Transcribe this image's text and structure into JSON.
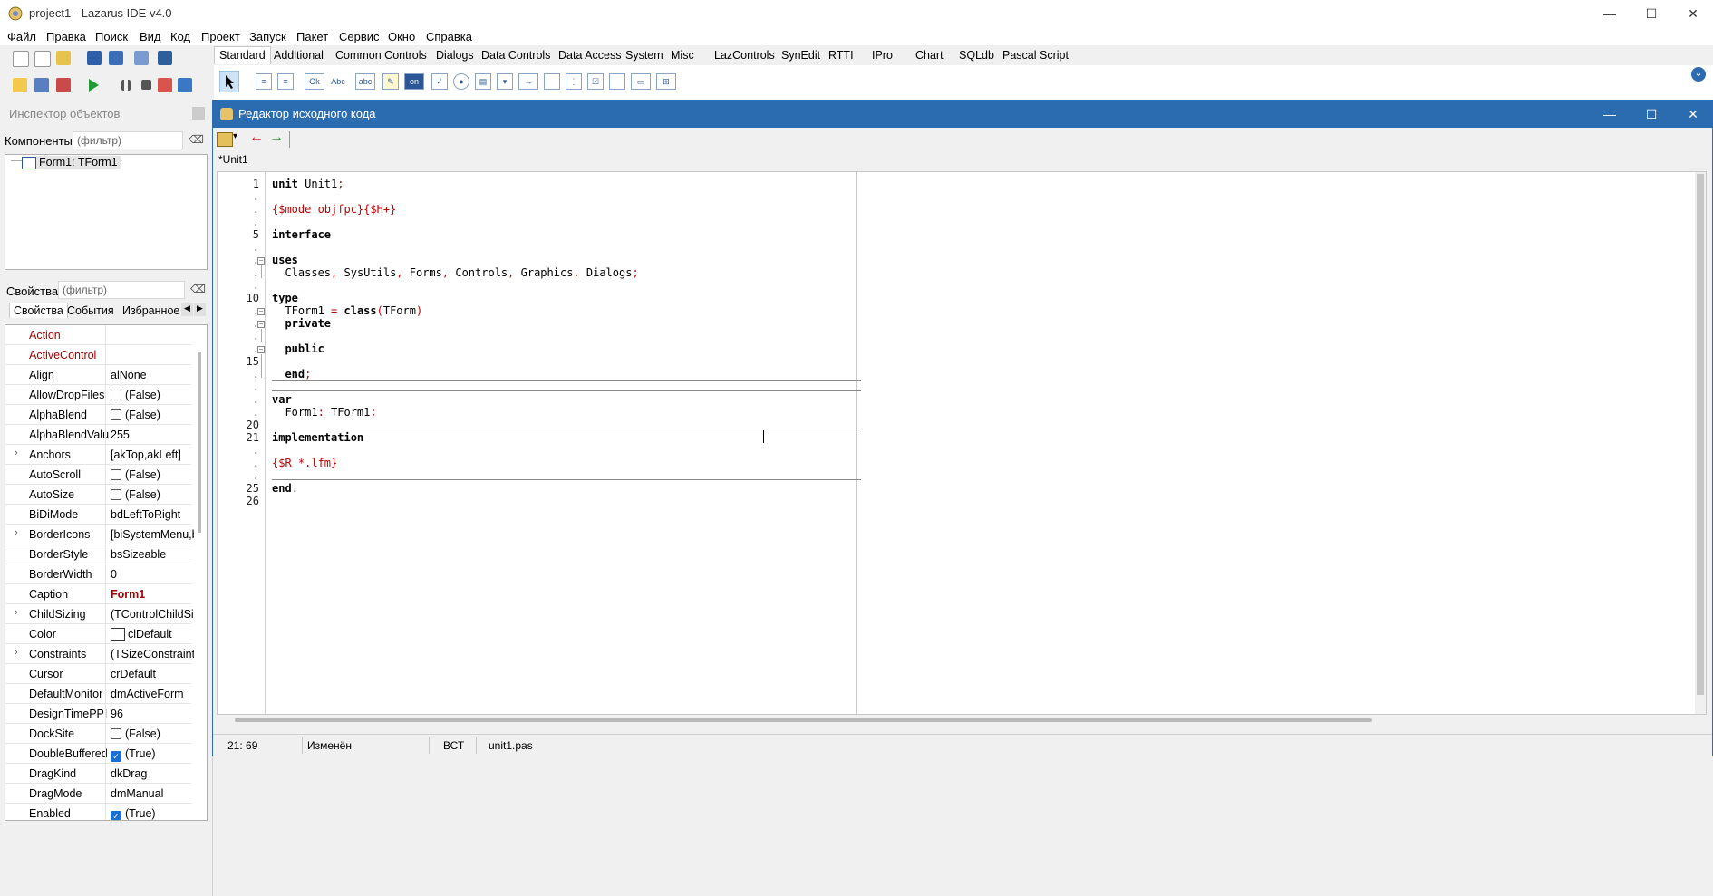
{
  "window": {
    "title": "project1  - Lazarus IDE v4.0",
    "minimize": "—",
    "maximize": "☐",
    "close": "✕"
  },
  "menu": [
    "Файл",
    "Правка",
    "Поиск",
    "Вид",
    "Код",
    "Проект",
    "Запуск",
    "Пакет",
    "Сервис",
    "Окно",
    "Справка"
  ],
  "palette": {
    "tabs": [
      "Standard",
      "Additional",
      "Common Controls",
      "Dialogs",
      "Data Controls",
      "Data Access",
      "System",
      "Misc",
      "LazControls",
      "SynEdit",
      "RTTI",
      "IPro",
      "Chart",
      "SQLdb",
      "Pascal Script"
    ],
    "active_tab": "Standard",
    "expand": "⌄"
  },
  "inspector": {
    "title": "Инспектор объектов",
    "components_label": "Компоненты",
    "components_filter_placeholder": "(фильтр)",
    "tree_item": "Form1: TForm1",
    "properties_label": "Свойства",
    "properties_filter_placeholder": "(фильтр)",
    "tabs": [
      "Свойства",
      "События",
      "Избранное"
    ],
    "properties": [
      {
        "name": "Action",
        "value": "",
        "red": true
      },
      {
        "name": "ActiveControl",
        "value": "",
        "red": true
      },
      {
        "name": "Align",
        "value": "alNone"
      },
      {
        "name": "AllowDropFiles",
        "value": "(False)",
        "check": false
      },
      {
        "name": "AlphaBlend",
        "value": "(False)",
        "check": false
      },
      {
        "name": "AlphaBlendValu",
        "value": "255"
      },
      {
        "name": "Anchors",
        "value": "[akTop,akLeft]",
        "expand": true
      },
      {
        "name": "AutoScroll",
        "value": "(False)",
        "check": false
      },
      {
        "name": "AutoSize",
        "value": "(False)",
        "check": false
      },
      {
        "name": "BiDiMode",
        "value": "bdLeftToRight"
      },
      {
        "name": "BorderIcons",
        "value": "[biSystemMenu,b",
        "expand": true
      },
      {
        "name": "BorderStyle",
        "value": "bsSizeable"
      },
      {
        "name": "BorderWidth",
        "value": "0"
      },
      {
        "name": "Caption",
        "value": "Form1",
        "bold": true
      },
      {
        "name": "ChildSizing",
        "value": "(TControlChildSiz",
        "expand": true
      },
      {
        "name": "Color",
        "value": "clDefault",
        "swatch": true
      },
      {
        "name": "Constraints",
        "value": "(TSizeConstraints",
        "expand": true
      },
      {
        "name": "Cursor",
        "value": "crDefault"
      },
      {
        "name": "DefaultMonitor",
        "value": "dmActiveForm"
      },
      {
        "name": "DesignTimePPI",
        "value": "96"
      },
      {
        "name": "DockSite",
        "value": "(False)",
        "check": false
      },
      {
        "name": "DoubleBuffered",
        "value": "(True)",
        "check": true
      },
      {
        "name": "DragKind",
        "value": "dkDrag"
      },
      {
        "name": "DragMode",
        "value": "dmManual"
      },
      {
        "name": "Enabled",
        "value": "(True)",
        "check": true
      }
    ]
  },
  "editor": {
    "title": "Редактор исходного кода",
    "tab": "*Unit1",
    "line_numbers": [
      "1",
      ".",
      ".",
      ".",
      "5",
      ".",
      ".",
      ".",
      ".",
      "10",
      ".",
      ".",
      ".",
      ".",
      "15",
      ".",
      ".",
      ".",
      ".",
      "20",
      "21",
      ".",
      ".",
      ".",
      "25",
      "26"
    ],
    "status": {
      "position": "21: 69",
      "modified": "Изменён",
      "mode": "ВСТ",
      "file": "unit1.pas"
    }
  }
}
